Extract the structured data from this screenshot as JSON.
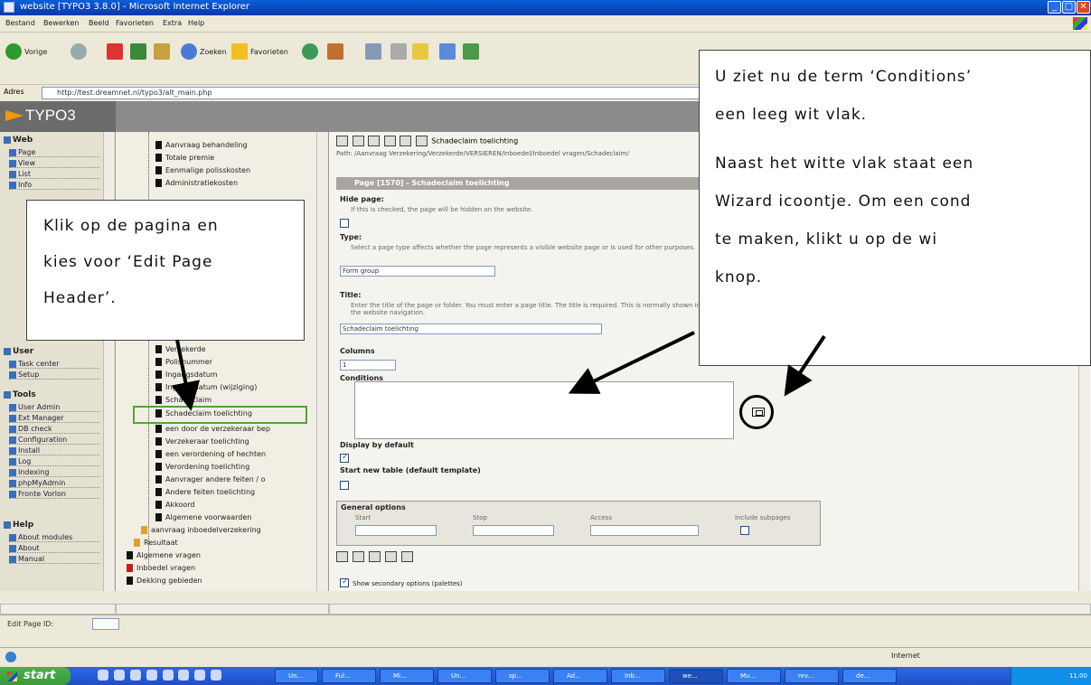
{
  "window": {
    "title": "website [TYPO3 3.8.0] - Microsoft Internet Explorer",
    "minimize": "_",
    "maximize": "□",
    "close": "✕"
  },
  "menu": [
    "Bestand",
    "Bewerken",
    "Beeld",
    "Favorieten",
    "Extra",
    "Help"
  ],
  "toolbar": {
    "back": "Vorige",
    "search": "Zoeken",
    "favorites": "Favorieten"
  },
  "address": {
    "label": "Adres",
    "value": "http://test.dreamnet.nl/typo3/alt_main.php"
  },
  "typo3": {
    "logo": "TYPO3"
  },
  "modules": {
    "groups": [
      {
        "label": "Web",
        "items": [
          "Page",
          "View",
          "List",
          "Info"
        ]
      },
      {
        "label": "User",
        "items": [
          "Task center",
          "Setup"
        ]
      },
      {
        "label": "Tools",
        "items": [
          "User Admin",
          "Ext Manager",
          "DB check",
          "Configuration",
          "Install",
          "Log",
          "Indexing",
          "phpMyAdmin",
          "Fronte Vorlon"
        ]
      },
      {
        "label": "Help",
        "items": [
          "About modules",
          "About",
          "Manual"
        ]
      }
    ]
  },
  "tree": {
    "items": [
      "Aanvraag behandeling",
      "Totale premie",
      "Eenmalige polisskosten",
      "Administratiekosten",
      "Verzekerde",
      "Polisnummer",
      "Ingangsdatum",
      "Ingangsdatum (wijziging)",
      "Schadeclaim",
      "Schadeclaim toelichting",
      "een door de verzekeraar bep",
      "Verzekeraar toelichting",
      "een verordening of hechten",
      "Verordening toelichting",
      "Aanvrager andere feiten / o",
      "Andere feiten toelichting",
      "Akkoord",
      "Algemene voorwaarden",
      "aanvraag inboedelverzekering",
      "Resultaat",
      "Algemene vragen",
      "Inboedel vragen",
      "Dekking gebieden"
    ]
  },
  "content": {
    "docheader_title": "Schadeclaim toelichting",
    "path": "Path: /Aanvraag Verzekering/Verzekerde/VERSIEREN/Inboedel/Inboedel vragen/Schadeclaim/",
    "section": "Page [1570] - Schadeclaim toelichting",
    "hide_page": {
      "label": "Hide page:",
      "help": "If this is checked, the page will be hidden on the website."
    },
    "type": {
      "label": "Type:",
      "help": "Select a page type affects whether the page represents a visible website page or is used for other purposes.",
      "value": "Form group"
    },
    "title_field": {
      "label": "Title:",
      "help": "Enter the title of the page or folder. You must enter a page title. The title is required. This is normally shown in the website navigation.",
      "value": "Schadeclaim toelichting"
    },
    "columns": {
      "label": "Columns",
      "value": "1"
    },
    "conditions": {
      "label": "Conditions"
    },
    "display_default": {
      "label": "Display by default"
    },
    "new_table": {
      "label": "Start new table (default template)"
    },
    "general_options": {
      "label": "General options",
      "cols": [
        "Start",
        "Stop",
        "Access",
        "Include subpages"
      ]
    },
    "secondary_options": "Show secondary options (palettes)"
  },
  "page_id": {
    "label": "Edit Page ID:",
    "value": ""
  },
  "status": {
    "zone": "Internet"
  },
  "taskbar": {
    "start": "start",
    "tasks": [
      "Un...",
      "Ful...",
      "Mi...",
      "Un...",
      "sp...",
      "Ad...",
      "Inb...",
      "we...",
      "Mu...",
      "rev...",
      "de..."
    ],
    "clock": "11:00"
  },
  "callouts": {
    "left": [
      "Klik op de pagina en",
      "kies voor ‘Edit Page",
      "Header’."
    ],
    "right": [
      "U ziet nu de term ‘Conditions’",
      "een leeg wit vlak.",
      "Naast het witte vlak staat een",
      "Wizard icoontje. Om een cond",
      "te maken, klikt u op de wi",
      "knop."
    ]
  }
}
